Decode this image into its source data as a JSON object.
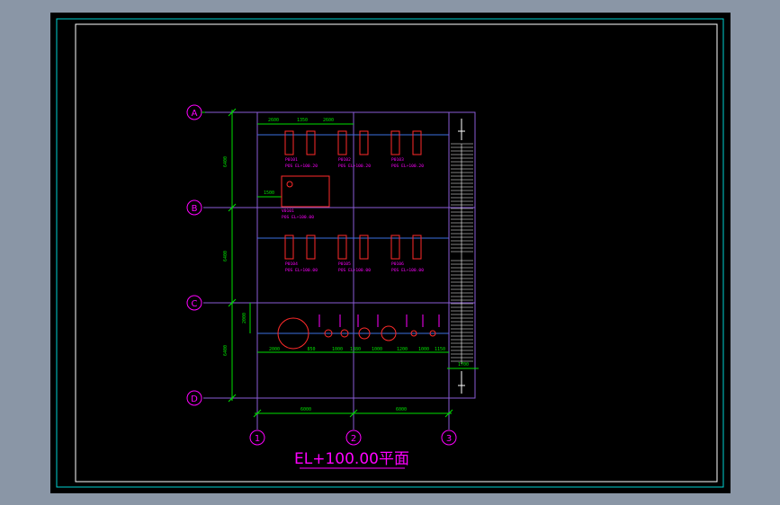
{
  "title": "EL+100.00平面",
  "axes": {
    "rows": [
      "A",
      "B",
      "C",
      "D"
    ],
    "cols": [
      "1",
      "2",
      "3"
    ]
  },
  "dims": {
    "left_1": "6400",
    "left_2": "6400",
    "left_3": "6400",
    "left_small": "2000",
    "bottom_1": "6000",
    "bottom_2": "6000",
    "top_1": "2600",
    "top_2": "1350",
    "top_3": "2600",
    "b_small": "1500",
    "r1": "2000",
    "r2": "850",
    "r3": "1000",
    "r4": "1380",
    "r5": "1000",
    "r6": "1200",
    "r7": "1000",
    "r8": "1150",
    "side": "1700"
  },
  "equipment": {
    "e1_tag": "P0101",
    "e1_note": "POS EL+100.20",
    "e2_tag": "P0102",
    "e2_note": "POS EL+100.20",
    "e3_tag": "P0103",
    "e3_note": "POS EL+100.20",
    "box_tag": "V0101",
    "box_note": "POS EL+100.00",
    "e4_tag": "P0104",
    "e4_note": "POS EL+100.00",
    "e5_tag": "P0105",
    "e5_note": "POS EL+100.00",
    "e6_tag": "P0106",
    "e6_note": "POS EL+100.00"
  },
  "colors": {
    "background": "#000000",
    "grid": "#8a5bd6",
    "dimension": "#00e000",
    "equipment": "#ff2a2a",
    "label": "#ff00ff",
    "frame": "#00d2d2"
  }
}
